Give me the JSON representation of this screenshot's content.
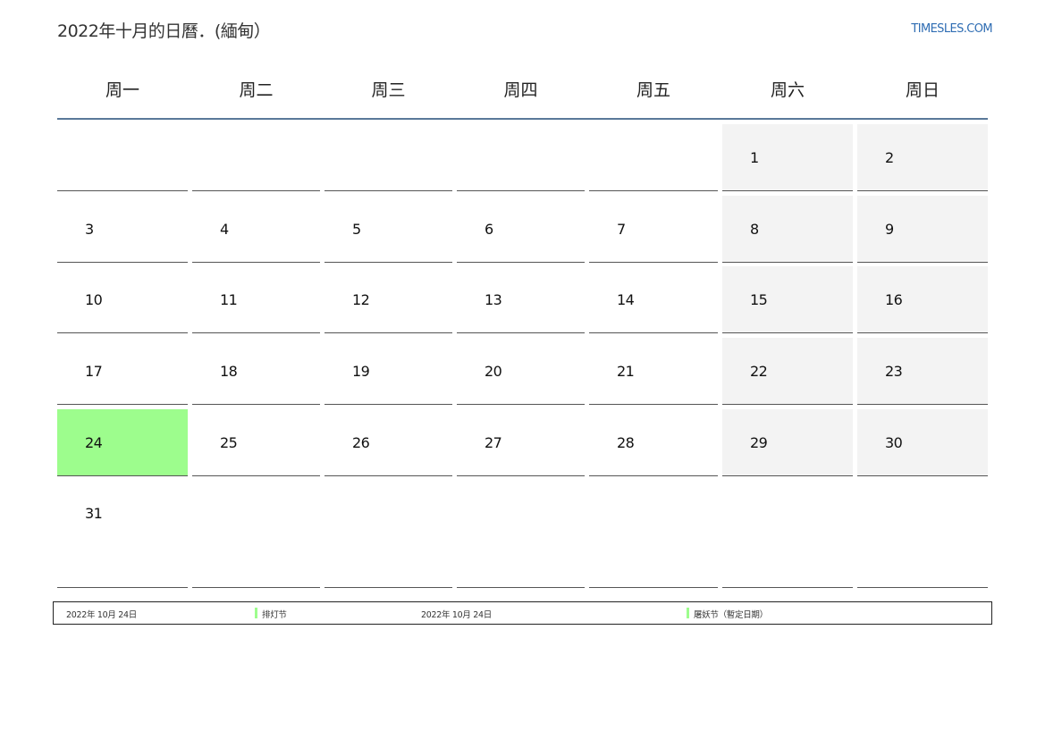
{
  "header": {
    "title": "2022年十月的日曆．(緬甸）",
    "site": "TIMESLES.COM"
  },
  "weekdays": [
    "周一",
    "周二",
    "周三",
    "周四",
    "周五",
    "周六",
    "周日"
  ],
  "weeks": [
    [
      "",
      "",
      "",
      "",
      "",
      "1",
      "2"
    ],
    [
      "3",
      "4",
      "5",
      "6",
      "7",
      "8",
      "9"
    ],
    [
      "10",
      "11",
      "12",
      "13",
      "14",
      "15",
      "16"
    ],
    [
      "17",
      "18",
      "19",
      "20",
      "21",
      "22",
      "23"
    ],
    [
      "24",
      "25",
      "26",
      "27",
      "28",
      "29",
      "30"
    ],
    [
      "31",
      "",
      "",
      "",
      "",
      "",
      ""
    ]
  ],
  "highlighted_day": "24",
  "colors": {
    "holiday_highlight": "#9dfd8d",
    "weekend_background": "#f3f3f3",
    "header_rule": "#5a7899",
    "link": "#2f6db3"
  },
  "holidays": [
    {
      "date": "2022年 10月 24日",
      "name": "排灯节"
    },
    {
      "date": "2022年 10月 24日",
      "name": "屠妖节（暫定日期）"
    }
  ]
}
